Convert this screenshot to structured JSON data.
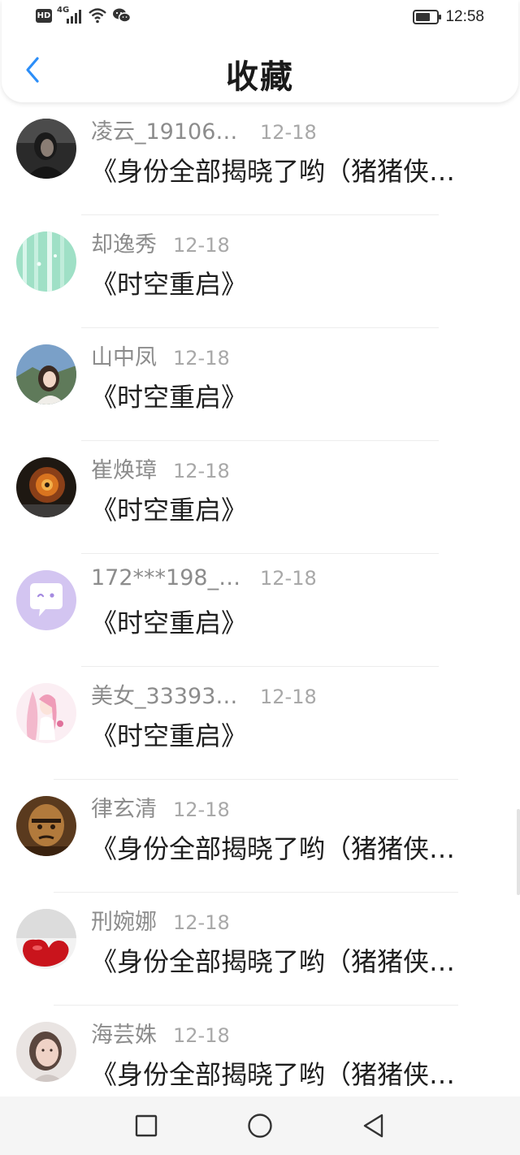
{
  "status_bar": {
    "hd": "HD",
    "network": "4G",
    "battery_level": 0.72,
    "time": "12:58",
    "icons": [
      "hd-icon",
      "signal-icon",
      "wifi-icon",
      "wechat-icon",
      "battery-icon"
    ]
  },
  "header": {
    "title": "收藏",
    "back_icon": "chevron-left-icon",
    "accent": "#2c8ef8"
  },
  "items": [
    {
      "name": "凌云_19106…",
      "date": "12-18",
      "title": "《身份全部揭晓了哟（猪猪侠…"
    },
    {
      "name": "却逸秀",
      "date": "12-18",
      "title": "《时空重启》"
    },
    {
      "name": "山中凤",
      "date": "12-18",
      "title": "《时空重启》"
    },
    {
      "name": "崔焕璋",
      "date": "12-18",
      "title": "《时空重启》"
    },
    {
      "name": "172***198_…",
      "date": "12-18",
      "title": "《时空重启》"
    },
    {
      "name": "美女_33393…",
      "date": "12-18",
      "title": "《时空重启》"
    },
    {
      "name": "律玄清",
      "date": "12-18",
      "title": "《身份全部揭晓了哟（猪猪侠…"
    },
    {
      "name": "刑婉娜",
      "date": "12-18",
      "title": "《身份全部揭晓了哟（猪猪侠…"
    },
    {
      "name": "海芸姝",
      "date": "12-18",
      "title": "《身份全部揭晓了哟（猪猪侠…"
    }
  ],
  "nav": {
    "icons": [
      "recents-square-icon",
      "home-circle-icon",
      "back-triangle-icon"
    ]
  }
}
